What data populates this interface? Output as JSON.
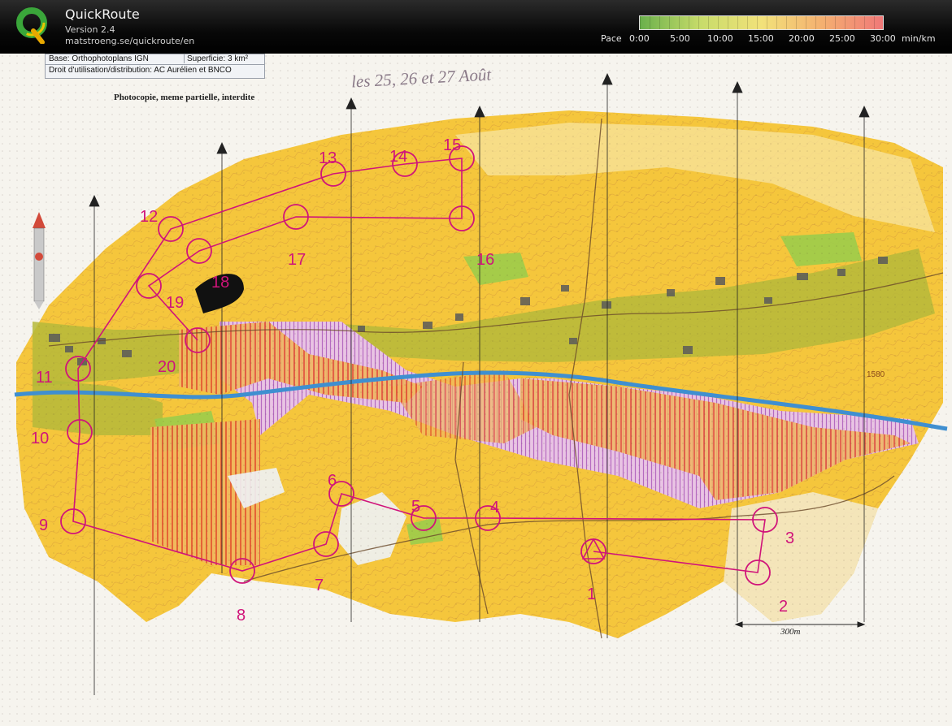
{
  "app": {
    "title": "QuickRoute",
    "version": "Version 2.4",
    "url": "matstroeng.se/quickroute/en",
    "logo_icon": "quickroute-q-logo"
  },
  "pace_scale": {
    "label": "Pace",
    "ticks": [
      "0:00",
      "5:00",
      "10:00",
      "15:00",
      "20:00",
      "25:00",
      "30:00"
    ],
    "unit": "min/km",
    "colors": [
      "#6ab04c",
      "#c8dc6a",
      "#f2e27a",
      "#f4b070",
      "#f07878"
    ]
  },
  "map": {
    "info_base": "Base: Orthophotoplans IGN",
    "info_surface": "Superficie: 3 km²",
    "info_rights": "Droit d'utilisation/distribution: AC Aurélien et BNCO",
    "photocopy_note": "Photocopie, meme partielle, interdite",
    "event_dates": "les 25, 26 et 27 Août",
    "scale_label": "300m",
    "height_label": "1580",
    "course_color": "#d0147a",
    "controls": [
      {
        "label": "1"
      },
      {
        "label": "2"
      },
      {
        "label": "3"
      },
      {
        "label": "4"
      },
      {
        "label": "5"
      },
      {
        "label": "6"
      },
      {
        "label": "7"
      },
      {
        "label": "8"
      },
      {
        "label": "9"
      },
      {
        "label": "10"
      },
      {
        "label": "11"
      },
      {
        "label": "12"
      },
      {
        "label": "13"
      },
      {
        "label": "14"
      },
      {
        "label": "15"
      },
      {
        "label": "16"
      },
      {
        "label": "17"
      },
      {
        "label": "18"
      },
      {
        "label": "19"
      },
      {
        "label": "20"
      }
    ]
  }
}
